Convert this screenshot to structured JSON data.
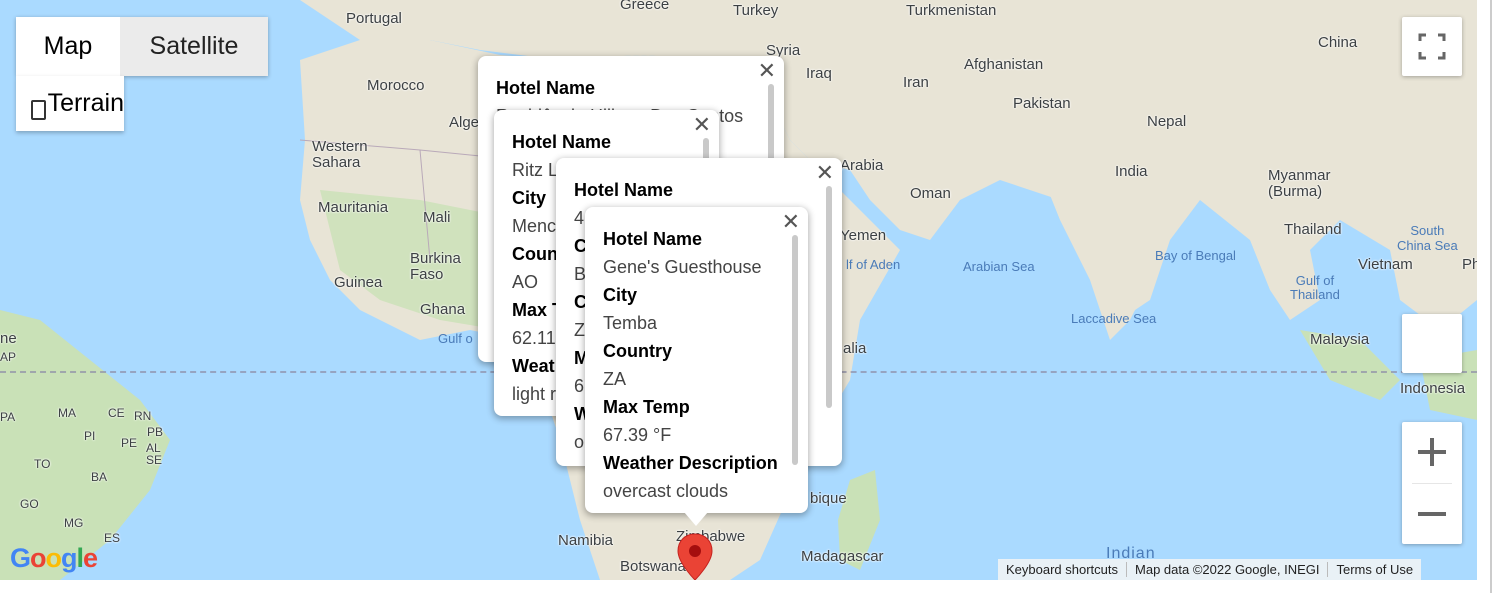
{
  "map_type_control": {
    "map_label": "Map",
    "satellite_label": "Satellite",
    "terrain_label": "Terrain",
    "terrain_checked": false,
    "active": "Map"
  },
  "place_labels": {
    "portugal": "Portugal",
    "greece": "Greece",
    "turkey": "Turkey",
    "turkmenistan": "Turkmenistan",
    "china": "China",
    "syria": "Syria",
    "iraq": "Iraq",
    "iran": "Iran",
    "afghanistan": "Afghanistan",
    "pakistan": "Pakistan",
    "nepal": "Nepal",
    "morocco": "Morocco",
    "algeria": "Alge",
    "western_sahara": "Western\nSahara",
    "mauritania": "Mauritania",
    "mali": "Mali",
    "burkina_faso": "Burkina\nFaso",
    "guinea": "Guinea",
    "ghana": "Ghana",
    "gulf_of_guinea": "Gulf o",
    "arabia": "Arabia",
    "oman": "Oman",
    "yemen": "Yemen",
    "gulf_of_aden": "lf of Aden",
    "arabian_sea": "Arabian Sea",
    "india": "India",
    "bay_of_bengal": "Bay of Bengal",
    "myanmar": "Myanmar\n(Burma)",
    "south_china_sea": "South\nChina Sea",
    "thailand": "Thailand",
    "vietnam": "Vietnam",
    "philippines_partial": "Ph",
    "gulf_of_thailand": "Gulf of\nThailand",
    "laccadive_sea": "Laccadive Sea",
    "malaysia": "Malaysia",
    "indonesia": "Indonesia",
    "somalia_partial": "alia",
    "mozambique_partial": "bique",
    "namibia": "Namibia",
    "zimbabwe": "Zimbabwe",
    "botswana": "Botswana",
    "madagascar": "Madagascar",
    "indian_ocean": "Indian",
    "brazil_states": [
      "MA",
      "CE",
      "RN",
      "PI",
      "PE",
      "PB",
      "AL",
      "SE",
      "TO",
      "BA",
      "GO",
      "MG",
      "ES",
      "PA",
      "AP",
      "ne"
    ]
  },
  "info_windows": [
    {
      "id": "iw1",
      "fields": [
        {
          "heading": "Hotel Name",
          "value": "Residência Hiliana Dos Santos"
        }
      ]
    },
    {
      "id": "iw2",
      "fields": [
        {
          "heading": "Hotel Name",
          "value": "Ritz L"
        },
        {
          "heading": "City",
          "value": "Menc"
        },
        {
          "heading": "Coun",
          "value": "AO"
        },
        {
          "heading": "Max T",
          "value": "62.11"
        },
        {
          "heading": "Weat",
          "value": "light r"
        }
      ]
    },
    {
      "id": "iw3",
      "fields": [
        {
          "heading": "Hotel Name",
          "value": "4"
        },
        {
          "heading": "C",
          "value": "B"
        },
        {
          "heading": "C",
          "value": "Z"
        },
        {
          "heading": "M",
          "value": "6"
        },
        {
          "heading": "W",
          "value": "o"
        }
      ]
    },
    {
      "id": "iw4",
      "fields": [
        {
          "heading": "Hotel Name",
          "value": "Gene's Guesthouse"
        },
        {
          "heading": "City",
          "value": "Temba"
        },
        {
          "heading": "Country",
          "value": "ZA"
        },
        {
          "heading": "Max Temp",
          "value": "67.39 °F"
        },
        {
          "heading": "Weather Description",
          "value": "overcast clouds"
        }
      ]
    }
  ],
  "iw3_extra": "s",
  "iw1_extra": "antos",
  "attribution": {
    "keyboard": "Keyboard shortcuts",
    "map_data": "Map data ©2022 Google, INEGI",
    "terms": "Terms of Use"
  },
  "logo": {
    "letters": [
      "G",
      "o",
      "o",
      "g",
      "l",
      "e"
    ],
    "colors": [
      "#4285f4",
      "#ea4335",
      "#fbbc05",
      "#4285f4",
      "#34a853",
      "#ea4335"
    ]
  },
  "colors": {
    "water": "#aadaff",
    "land": "#e8e4d6",
    "green": "#c9e1b7",
    "marker": "#ea4335"
  },
  "icons": {
    "fullscreen": "fullscreen-icon",
    "pegman": "pegman-icon",
    "zoom_in": "plus-icon",
    "zoom_out": "minus-icon",
    "close": "close-icon",
    "marker": "map-marker-icon"
  }
}
